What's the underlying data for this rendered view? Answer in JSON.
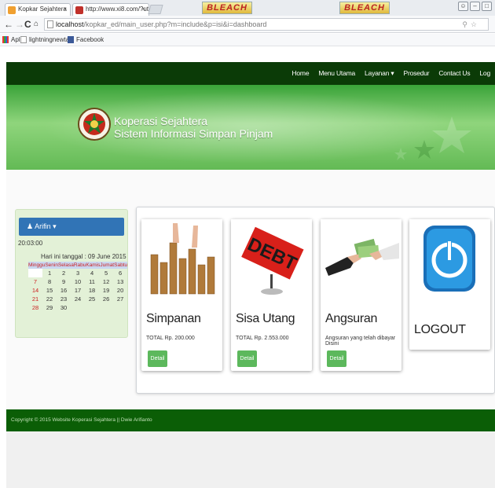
{
  "browser": {
    "tabs": [
      {
        "label": "Kopkar Sejahtera",
        "close": "×"
      },
      {
        "label": "http://www.xi8.com/?utm",
        "close": "×"
      }
    ],
    "banner_text": "BLEACH",
    "url_host": "localhost",
    "url_path": "/kopkar_ed/main_user.php?m=include&p=isi&i=dashboard",
    "bookmarks": [
      "Apl",
      "lightningnewtab",
      "Facebook"
    ]
  },
  "nav": {
    "items": [
      "Home",
      "Menu Utama",
      "Layanan ▾",
      "Prosedur",
      "Contact Us",
      "Log"
    ]
  },
  "banner": {
    "line1": "Koperasi Sejahtera",
    "line2": "Sistem Informasi Simpan Pinjam"
  },
  "sidebar": {
    "user": "Arifin ▾",
    "time": "20:03:00",
    "date_line": "Hari ini tanggal : 09 June 2015",
    "calendar": {
      "header": "MingguSeninSelasaRabuKamisJumatSabtu",
      "weeks": [
        [
          "",
          "1",
          "2",
          "3",
          "4",
          "5",
          "6"
        ],
        [
          "7",
          "8",
          "9",
          "10",
          "11",
          "12",
          "13"
        ],
        [
          "14",
          "15",
          "16",
          "17",
          "18",
          "19",
          "20"
        ],
        [
          "21",
          "22",
          "23",
          "24",
          "25",
          "26",
          "27"
        ],
        [
          "28",
          "29",
          "30",
          "",
          "",
          "",
          ""
        ]
      ]
    }
  },
  "cards": [
    {
      "title": "Simpanan",
      "sub": "TOTAL Rp. 200.000",
      "button": "Detail"
    },
    {
      "title": "Sisa Utang",
      "sub": "TOTAL Rp. 2.553.000",
      "button": "Detail",
      "image_text": "DEBT"
    },
    {
      "title": "Angsuran",
      "sub": "Angsuran yang telah dibayar Disini",
      "button": "Detail"
    },
    {
      "title": "LOGOUT",
      "sub": "",
      "button": ""
    }
  ],
  "footer": {
    "text": "Copyright © 2015 Website Koperasi Sejahtera || Dwie Arifianto"
  },
  "colors": {
    "navbar": "#0b3b07",
    "footer": "#0b5e06",
    "detail_button": "#5cb85c",
    "sidebar_head": "#3174b6"
  }
}
